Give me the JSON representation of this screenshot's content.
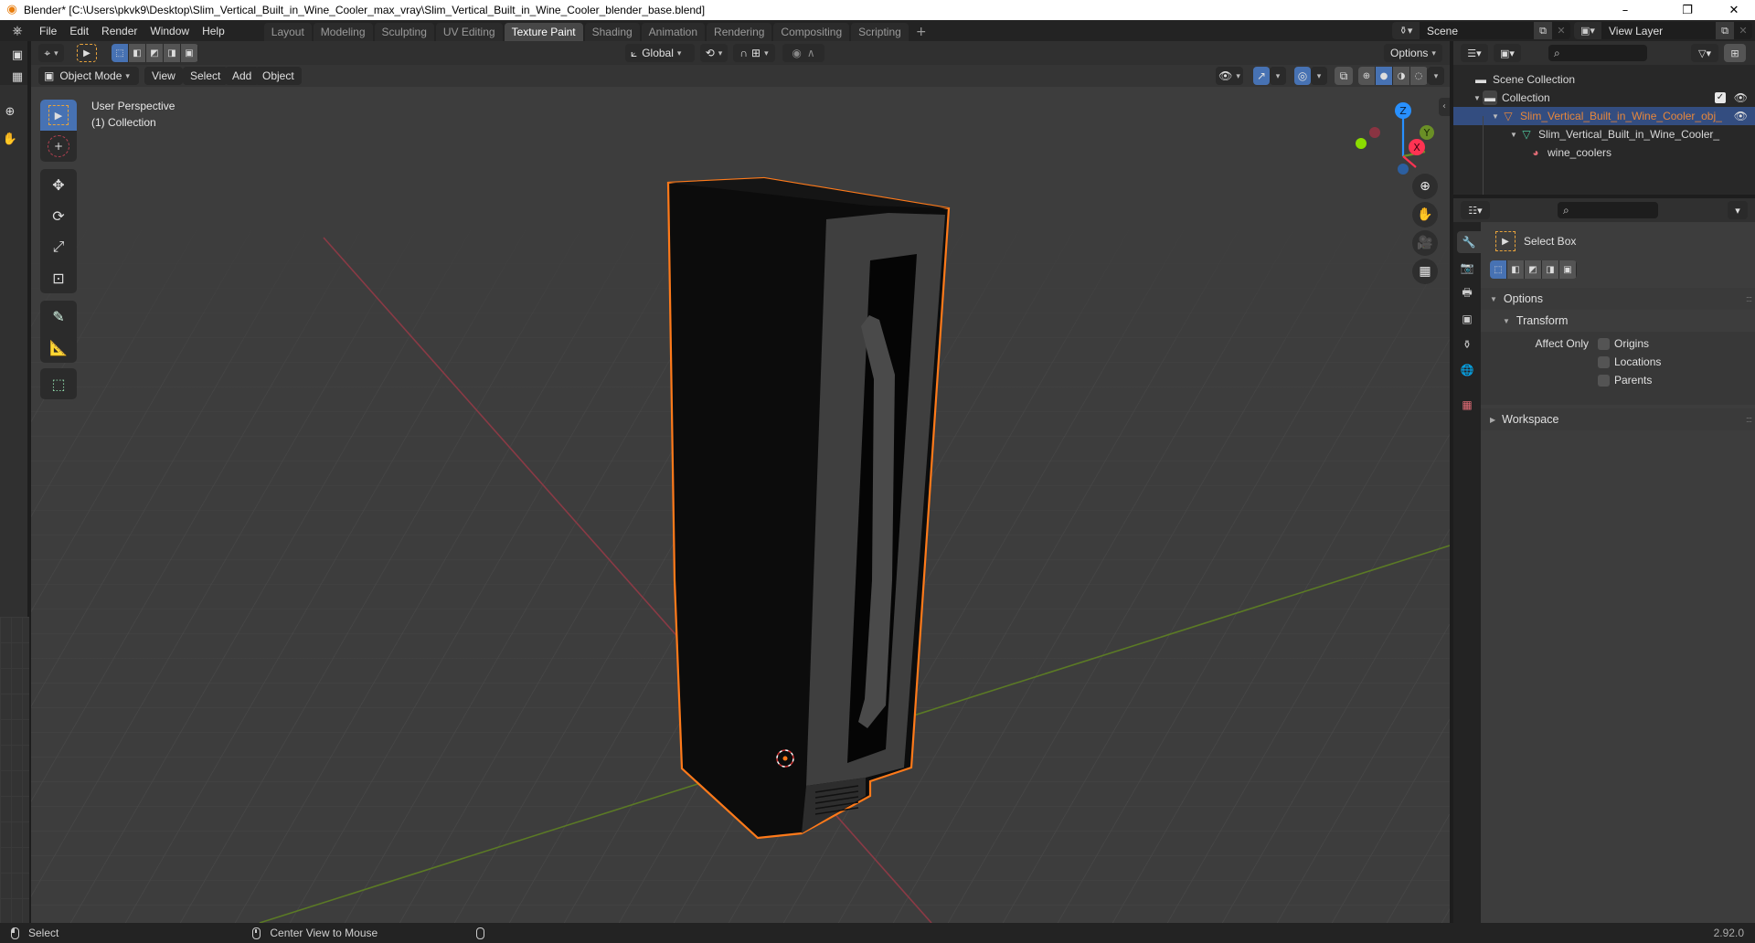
{
  "window": {
    "title": "Blender* [C:\\Users\\pkvk9\\Desktop\\Slim_Vertical_Built_in_Wine_Cooler_max_vray\\Slim_Vertical_Built_in_Wine_Cooler_blender_base.blend]",
    "minimize": "–",
    "maximize": "❐",
    "close": "✕"
  },
  "menu": [
    "File",
    "Edit",
    "Render",
    "Window",
    "Help"
  ],
  "workspaces": [
    {
      "label": "Layout",
      "active": false
    },
    {
      "label": "Modeling",
      "active": false
    },
    {
      "label": "Sculpting",
      "active": false
    },
    {
      "label": "UV Editing",
      "active": false
    },
    {
      "label": "Texture Paint",
      "active": true
    },
    {
      "label": "Shading",
      "active": false
    },
    {
      "label": "Animation",
      "active": false
    },
    {
      "label": "Rendering",
      "active": false
    },
    {
      "label": "Compositing",
      "active": false
    },
    {
      "label": "Scripting",
      "active": false
    }
  ],
  "workspace_add": "+",
  "scene": {
    "label": "Scene",
    "view_layer": "View Layer"
  },
  "viewport": {
    "transform_orientation": "Global",
    "options_label": "Options",
    "mode": "Object Mode",
    "header_menus": [
      "View",
      "Select",
      "Add",
      "Object"
    ],
    "overlay_info": {
      "line1": "User Perspective",
      "line2": "(1) Collection"
    },
    "gizmo_axes": {
      "x": "X",
      "y": "Y",
      "z": "Z"
    },
    "colors": {
      "x_axis": "#ff3352",
      "y_axis": "#8bdc00",
      "z_axis": "#2890ff",
      "selection_outline": "#ff7a1a",
      "active_tab": "#4772b3"
    }
  },
  "tools": [
    {
      "name": "select-box",
      "active": true
    },
    {
      "name": "cursor",
      "active": false
    },
    {
      "name": "move",
      "active": false
    },
    {
      "name": "rotate",
      "active": false
    },
    {
      "name": "scale",
      "active": false
    },
    {
      "name": "transform",
      "active": false
    },
    {
      "name": "annotate",
      "active": false
    },
    {
      "name": "measure",
      "active": false
    },
    {
      "name": "add-cube",
      "active": false
    }
  ],
  "outliner": {
    "search_placeholder": "",
    "rows": [
      {
        "label": "Scene Collection",
        "type": "scene-collection"
      },
      {
        "label": "Collection",
        "type": "collection",
        "checked": true
      },
      {
        "label": "Slim_Vertical_Built_in_Wine_Cooler_obj_",
        "type": "object",
        "selected": true
      },
      {
        "label": "Slim_Vertical_Built_in_Wine_Cooler_",
        "type": "mesh"
      },
      {
        "label": "wine_coolers",
        "type": "material"
      }
    ]
  },
  "properties": {
    "search_placeholder": "",
    "tool_name": "Select Box",
    "options_panel": "Options",
    "transform_subpanel": "Transform",
    "affect_only_label": "Affect Only",
    "affect_only": [
      {
        "label": "Origins",
        "checked": false
      },
      {
        "label": "Locations",
        "checked": false
      },
      {
        "label": "Parents",
        "checked": false
      }
    ],
    "workspace_panel": "Workspace"
  },
  "statusbar": {
    "left_action": "Select",
    "middle_action": "Center View to Mouse",
    "version": "2.92.0"
  }
}
